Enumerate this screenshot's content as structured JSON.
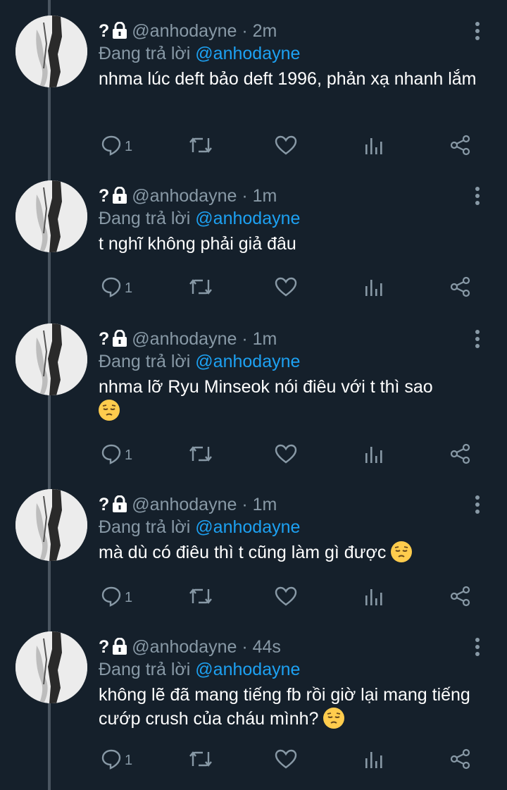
{
  "tweets": [
    {
      "name": "?",
      "handle": "@anhodayne",
      "time": "2m",
      "reply_prefix": "Đang trả lời",
      "reply_to": "@anhodayne",
      "text": "nhma lúc deft bảo deft 1996, phản xạ nhanh lắm",
      "emoji": false,
      "reply_count": "1"
    },
    {
      "name": "?",
      "handle": "@anhodayne",
      "time": "1m",
      "reply_prefix": "Đang trả lời",
      "reply_to": "@anhodayne",
      "text": "t nghĩ không phải giả đâu",
      "emoji": false,
      "reply_count": "1"
    },
    {
      "name": "?",
      "handle": "@anhodayne",
      "time": "1m",
      "reply_prefix": "Đang trả lời",
      "reply_to": "@anhodayne",
      "text": "nhma lỡ Ryu Minseok nói điêu với t thì sao",
      "emoji": true,
      "reply_count": "1"
    },
    {
      "name": "?",
      "handle": "@anhodayne",
      "time": "1m",
      "reply_prefix": "Đang trả lời",
      "reply_to": "@anhodayne",
      "text": "mà dù có điêu thì t cũng làm gì được",
      "emoji": true,
      "reply_count": "1"
    },
    {
      "name": "?",
      "handle": "@anhodayne",
      "time": "44s",
      "reply_prefix": "Đang trả lời",
      "reply_to": "@anhodayne",
      "text": "không lẽ đã mang tiếng fb rồi giờ lại mang tiếng cướp crush của cháu mình?",
      "emoji": true,
      "reply_count": "1"
    }
  ],
  "icons": {
    "reply": "reply-icon",
    "retweet": "retweet-icon",
    "like": "heart-icon",
    "analytics": "analytics-icon",
    "share": "share-icon",
    "more": "more-vertical-icon",
    "lock": "lock-icon",
    "emoji": "pensive-face-emoji"
  },
  "colors": {
    "background": "#15202b",
    "secondary_text": "#8899a6",
    "mention": "#1da1f2",
    "thread_line": "#4a5560"
  }
}
